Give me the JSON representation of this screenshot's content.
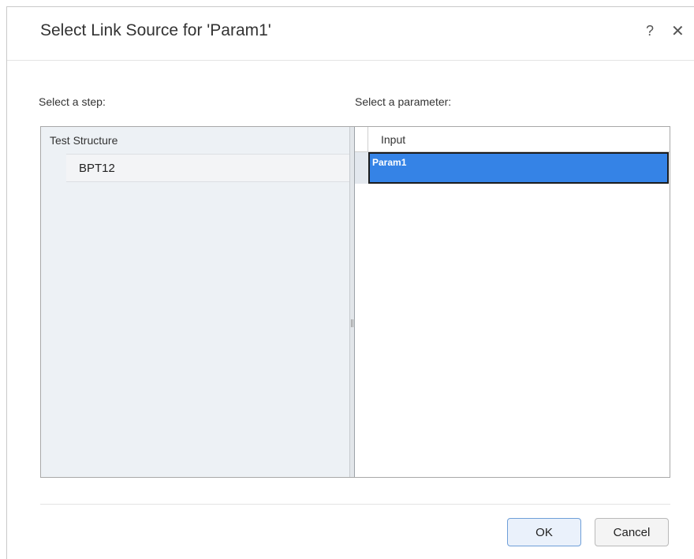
{
  "dialog": {
    "title": "Select Link Source for 'Param1'",
    "help_icon": "?",
    "close_icon": "✕"
  },
  "step_panel": {
    "label": "Select a step:",
    "tree": {
      "root_label": "Test Structure",
      "items": [
        {
          "label": "BPT12"
        }
      ]
    }
  },
  "parameter_panel": {
    "label": "Select a parameter:",
    "columns": [
      "Input"
    ],
    "rows": [
      {
        "value": "Param1",
        "selected": true
      }
    ]
  },
  "footer": {
    "ok_label": "OK",
    "cancel_label": "Cancel"
  },
  "colors": {
    "selection": "#3583e6",
    "left_pane_bg": "#edf1f5"
  }
}
